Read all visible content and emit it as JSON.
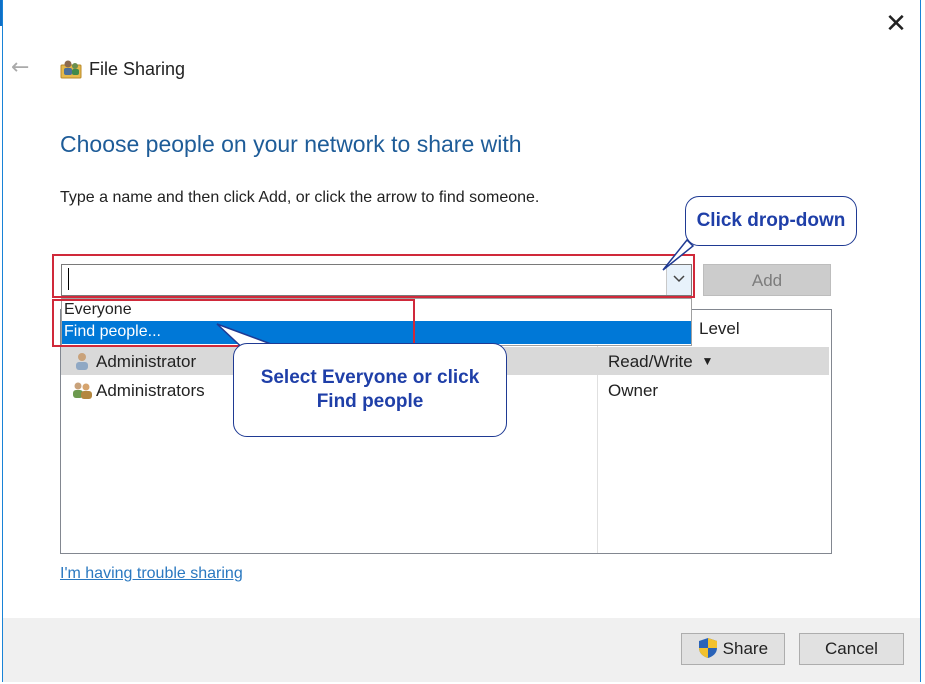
{
  "window": {
    "title": "File Sharing"
  },
  "heading": "Choose people on your network to share with",
  "instruction": "Type a name and then click Add, or click the arrow to find someone.",
  "name_input": {
    "value": ""
  },
  "add_label": "Add",
  "dropdown_options": [
    "Everyone",
    "Find people..."
  ],
  "list": {
    "level_header": "Level",
    "rows": [
      {
        "name": "Administrator",
        "level": "Read/Write",
        "selected": true
      },
      {
        "name": "Administrators",
        "level": "Owner",
        "selected": false
      }
    ]
  },
  "callouts": {
    "dropdown": "Click drop-down",
    "select": "Select Everyone or click Find people"
  },
  "trouble_link": "I'm having trouble sharing",
  "buttons": {
    "share": "Share",
    "cancel": "Cancel"
  },
  "colors": {
    "heading": "#1e5c98",
    "highlight": "#0078d7",
    "callout_text": "#1f3fa8",
    "annotation_box": "#d0293a"
  }
}
